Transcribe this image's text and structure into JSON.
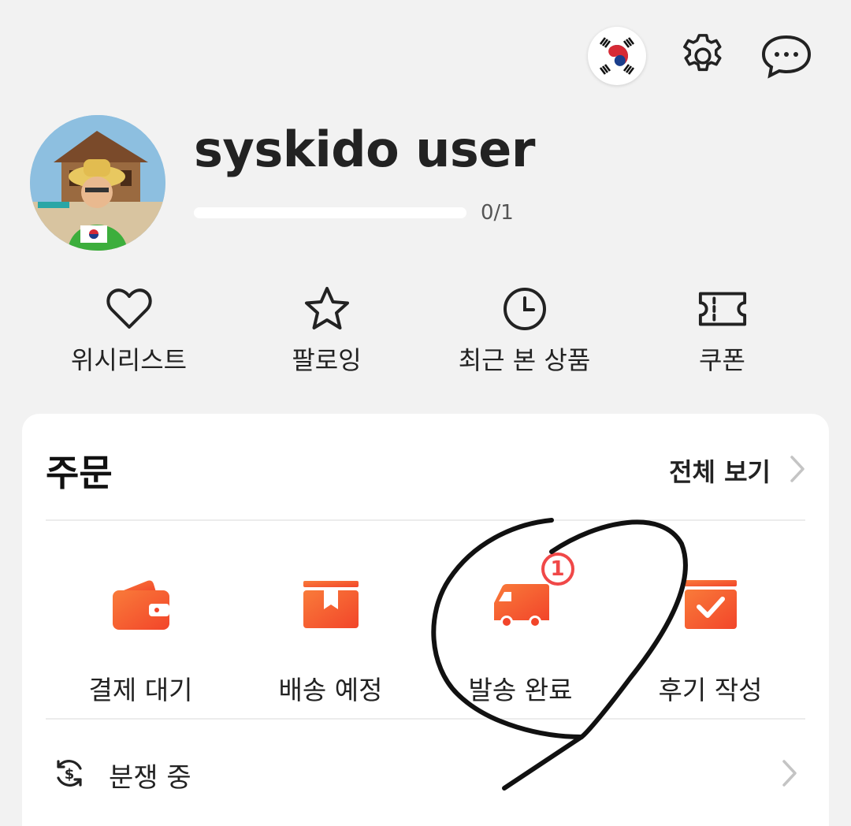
{
  "top_bar": {
    "icons": [
      "korea-flag-icon",
      "gear-icon",
      "chat-bubble-icon"
    ]
  },
  "profile": {
    "username": "syskido user",
    "level_progress": "0/1",
    "level_fraction": 0
  },
  "shortcuts": [
    {
      "label": "위시리스트",
      "icon": "heart-icon"
    },
    {
      "label": "팔로잉",
      "icon": "star-icon"
    },
    {
      "label": "최근 본 상품",
      "icon": "clock-icon"
    },
    {
      "label": "쿠폰",
      "icon": "ticket-icon"
    }
  ],
  "orders": {
    "title": "주문",
    "view_all": "전체 보기",
    "items": [
      {
        "label": "결제 대기",
        "icon": "wallet-icon"
      },
      {
        "label": "배송 예정",
        "icon": "package-icon"
      },
      {
        "label": "발송 완료",
        "icon": "truck-icon",
        "badge": "1"
      },
      {
        "label": "후기 작성",
        "icon": "review-box-icon"
      }
    ],
    "dispute": {
      "label": "분쟁 중",
      "icon": "dollar-refresh-icon"
    }
  },
  "colors": {
    "accent": "#f5572b",
    "badge": "#f04848",
    "background": "#f2f2f2"
  }
}
